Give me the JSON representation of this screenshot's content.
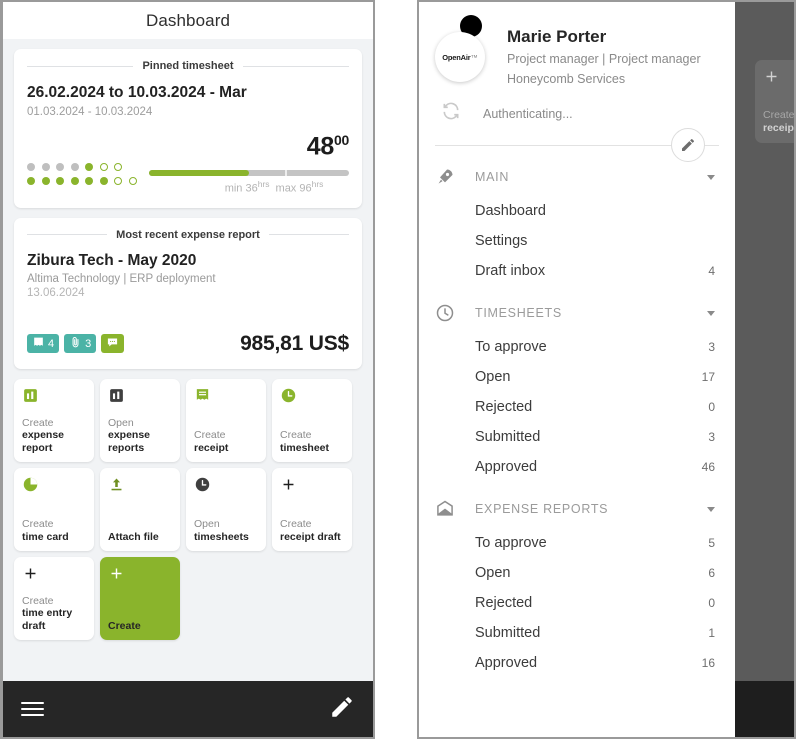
{
  "theme": {
    "accent": "#8ab42c",
    "teal": "#4bb3a6",
    "dark_bar": "#262626",
    "page_bg": "#f1f3f5"
  },
  "left_panel": {
    "appbar": {
      "title": "Dashboard"
    },
    "pinned_timesheet": {
      "header": "Pinned timesheet",
      "title": "26.02.2024 to 10.03.2024 - Mar",
      "subtitle": "01.03.2024 - 10.03.2024",
      "hours_whole": "48",
      "hours_fraction": "00",
      "min_label": "min 36",
      "min_unit": "hrs",
      "max_label": "max 96",
      "max_unit": "hrs",
      "fill_percent": 50,
      "tick_percent": 68,
      "dots_row1": [
        "grey",
        "grey",
        "grey",
        "grey",
        "green",
        "open",
        "open"
      ],
      "dots_row2": [
        "green",
        "green",
        "green",
        "green",
        "green",
        "green",
        "open",
        "open"
      ]
    },
    "expense_report": {
      "header": "Most recent expense report",
      "title": "Zibura Tech - May 2020",
      "subtitle": "Altima Technology | ERP deployment",
      "date": "13.06.2024",
      "amount": "985,81 US$",
      "badges": [
        {
          "icon": "receipt-icon",
          "count": "4",
          "color": "teal"
        },
        {
          "icon": "paperclip-icon",
          "count": "3",
          "color": "teal"
        },
        {
          "icon": "comment-icon",
          "count": "",
          "color": "green"
        }
      ]
    },
    "tiles": [
      {
        "icon": "bar-chart-icon",
        "icon_color": "#8ab42c",
        "line1": "Create",
        "line2": "expense report",
        "accent": false
      },
      {
        "icon": "bar-chart-icon",
        "icon_color": "#3f3f3f",
        "line1": "Open",
        "line2": "expense reports",
        "accent": false
      },
      {
        "icon": "receipt-icon",
        "icon_color": "#8ab42c",
        "line1": "Create",
        "line2": "receipt",
        "accent": false
      },
      {
        "icon": "clock-icon",
        "icon_color": "#8ab42c",
        "line1": "Create",
        "line2": "timesheet",
        "accent": false
      },
      {
        "icon": "pie-timer-icon",
        "icon_color": "#8ab42c",
        "line1": "Create",
        "line2": "time card",
        "accent": false
      },
      {
        "icon": "upload-icon",
        "icon_color": "#6f8f22",
        "line1": "",
        "line2": "Attach file",
        "accent": false
      },
      {
        "icon": "clock-icon",
        "icon_color": "#3f3f3f",
        "line1": "Open",
        "line2": "timesheets",
        "accent": false
      },
      {
        "icon": "plus-icon",
        "icon_color": "#1f1f1f",
        "line1": "Create",
        "line2": "receipt draft",
        "accent": false
      },
      {
        "icon": "plus-icon",
        "icon_color": "#1f1f1f",
        "line1": "Create",
        "line2": "time entry draft",
        "accent": false
      },
      {
        "icon": "plus-icon",
        "icon_color": "#ffffff",
        "line1": "",
        "line2": "Create",
        "accent": true
      }
    ],
    "bottom_bar": {
      "menu_icon": "hamburger-menu-icon",
      "edit_icon": "pencil-edit-icon"
    }
  },
  "right_panel": {
    "scrim_tile": {
      "icon": "plus-icon",
      "line1": "Create",
      "line2": "receipt draft"
    },
    "profile": {
      "logo_text": "OpenAir",
      "logo_mark": "™",
      "name": "Marie Porter",
      "role": "Project manager | Project manager",
      "company": "Honeycomb Services",
      "status": "Authenticating...",
      "sync_icon": "sync-refresh-icon",
      "edit_icon": "pencil-edit-icon"
    },
    "sections": [
      {
        "title": "MAIN",
        "icon": "rocket-icon",
        "items": [
          {
            "label": "Dashboard",
            "count": ""
          },
          {
            "label": "Settings",
            "count": ""
          },
          {
            "label": "Draft inbox",
            "count": "4"
          }
        ]
      },
      {
        "title": "TIMESHEETS",
        "icon": "clock-icon",
        "items": [
          {
            "label": "To approve",
            "count": "3"
          },
          {
            "label": "Open",
            "count": "17"
          },
          {
            "label": "Rejected",
            "count": "0"
          },
          {
            "label": "Submitted",
            "count": "3"
          },
          {
            "label": "Approved",
            "count": "46"
          }
        ]
      },
      {
        "title": "EXPENSE REPORTS",
        "icon": "envelope-icon",
        "items": [
          {
            "label": "To approve",
            "count": "5"
          },
          {
            "label": "Open",
            "count": "6"
          },
          {
            "label": "Rejected",
            "count": "0"
          },
          {
            "label": "Submitted",
            "count": "1"
          },
          {
            "label": "Approved",
            "count": "16"
          }
        ]
      }
    ]
  }
}
